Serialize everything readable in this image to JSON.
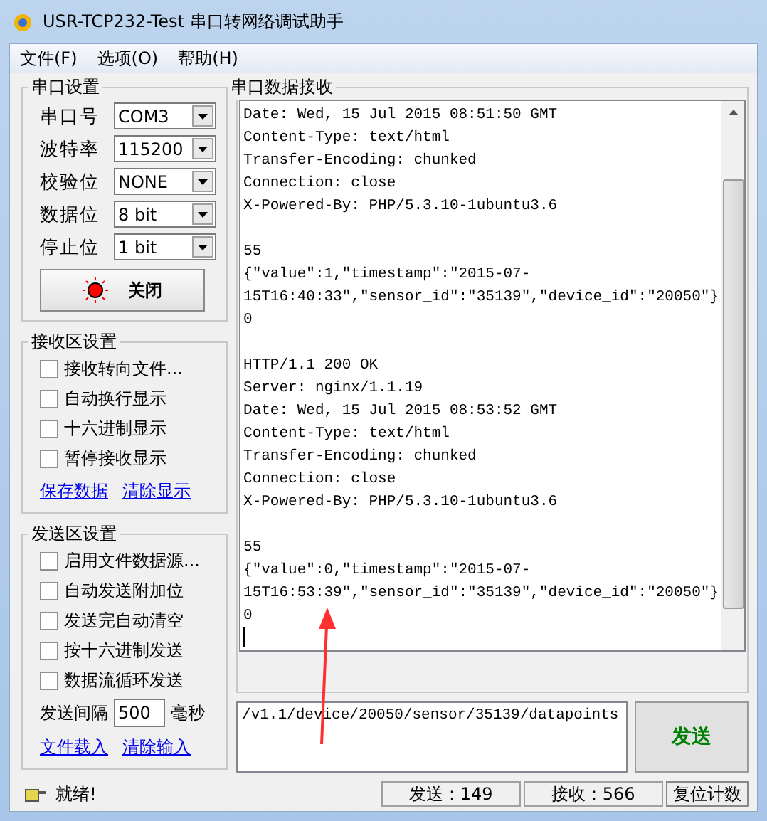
{
  "window": {
    "title": "USR-TCP232-Test 串口转网络调试助手"
  },
  "menu": [
    "文件(F)",
    "选项(O)",
    "帮助(H)"
  ],
  "serial_settings": {
    "title": "串口设置",
    "fields": [
      {
        "label": "串口号",
        "value": "COM3"
      },
      {
        "label": "波特率",
        "value": "115200"
      },
      {
        "label": "校验位",
        "value": "NONE"
      },
      {
        "label": "数据位",
        "value": "8 bit"
      },
      {
        "label": "停止位",
        "value": "1 bit"
      }
    ],
    "button": "关闭",
    "port_open": true
  },
  "receive_settings": {
    "title": "接收区设置",
    "options": [
      {
        "label": "接收转向文件...",
        "checked": false
      },
      {
        "label": "自动换行显示",
        "checked": false
      },
      {
        "label": "十六进制显示",
        "checked": false
      },
      {
        "label": "暂停接收显示",
        "checked": false
      }
    ],
    "links": [
      "保存数据",
      "清除显示"
    ]
  },
  "send_settings": {
    "title": "发送区设置",
    "options": [
      {
        "label": "启用文件数据源...",
        "checked": false
      },
      {
        "label": "自动发送附加位",
        "checked": false
      },
      {
        "label": "发送完自动清空",
        "checked": false
      },
      {
        "label": "按十六进制发送",
        "checked": false
      },
      {
        "label": "数据流循环发送",
        "checked": false
      }
    ],
    "interval_label": "发送间隔",
    "interval_value": "500",
    "interval_unit": "毫秒",
    "links": [
      "文件载入",
      "清除输入"
    ]
  },
  "receive_area": {
    "title": "串口数据接收",
    "blocks": [
      [
        "Date: Wed, 15 Jul 2015 08:51:50 GMT",
        "Content-Type: text/html",
        "Transfer-Encoding: chunked",
        "Connection: close",
        "X-Powered-By: PHP/5.3.10-1ubuntu3.6"
      ],
      [
        "55",
        "{\"value\":1,\"timestamp\":\"2015-07-",
        "15T16:40:33\",\"sensor_id\":\"35139\",\"device_id\":\"20050\"}",
        "0"
      ],
      [
        "HTTP/1.1 200 OK",
        "Server: nginx/1.1.19",
        "Date: Wed, 15 Jul 2015 08:53:52 GMT",
        "Content-Type: text/html",
        "Transfer-Encoding: chunked",
        "Connection: close",
        "X-Powered-By: PHP/5.3.10-1ubuntu3.6"
      ],
      [
        "55",
        "{\"value\":0,\"timestamp\":\"2015-07-",
        "15T16:53:39\",\"sensor_id\":\"35139\",\"device_id\":\"20050\"}",
        "0"
      ]
    ]
  },
  "send_area": {
    "value": "/v1.1/device/20050/sensor/35139/datapoints",
    "button": "发送"
  },
  "status": {
    "text": "就绪!",
    "sent": "发送 : 149",
    "received": "接收 : 566",
    "reset": "复位计数"
  }
}
